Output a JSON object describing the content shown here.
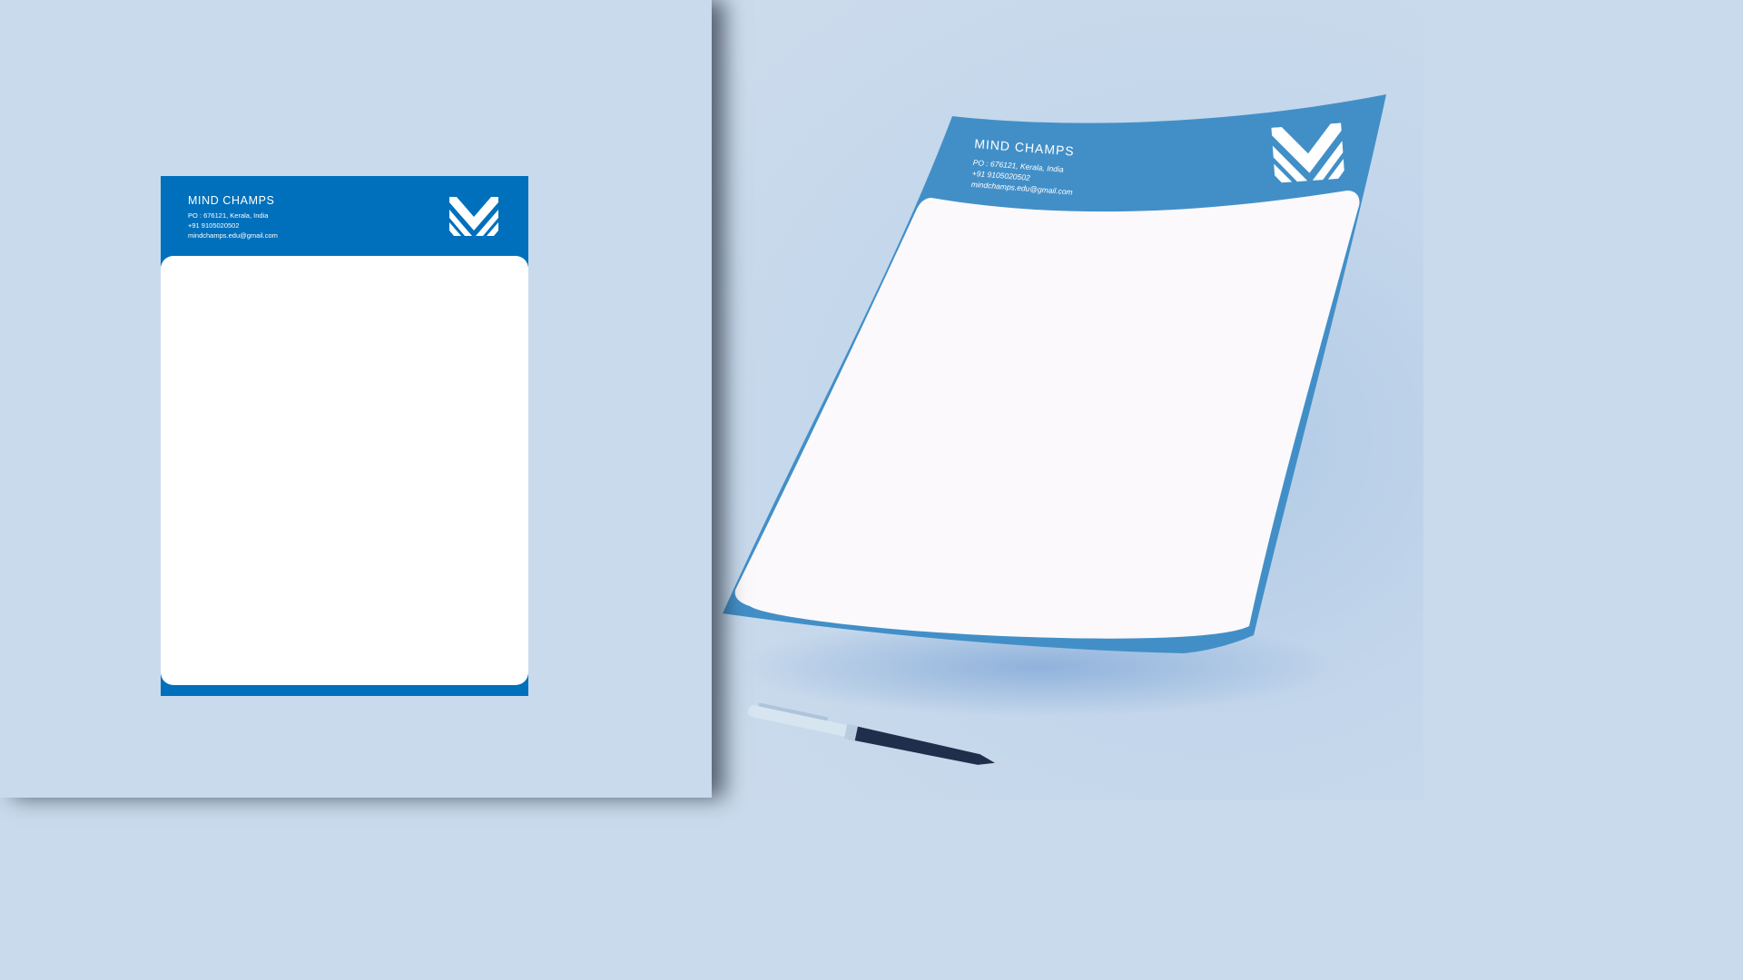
{
  "letterhead": {
    "company": "MIND CHAMPS",
    "address": "PO : 676121, Kerala, India",
    "phone": "+91 9105020502",
    "email": "mindchamps.edu@gmail.com",
    "logo_icon": "chevron-m-logo-icon"
  },
  "mockup": {
    "company": "MIND CHAMPS",
    "address": "PO : 676121, Kerala, India",
    "phone": "+91 9105020502",
    "email": "mindchamps.edu@gmail.com",
    "logo_icon": "chevron-m-logo-icon",
    "pen_icon": "ballpoint-pen-icon"
  },
  "colors": {
    "background": "#c9daed",
    "brand_blue": "#0070bc",
    "mockup_blue": "#428fc8",
    "paper": "#ffffff"
  }
}
